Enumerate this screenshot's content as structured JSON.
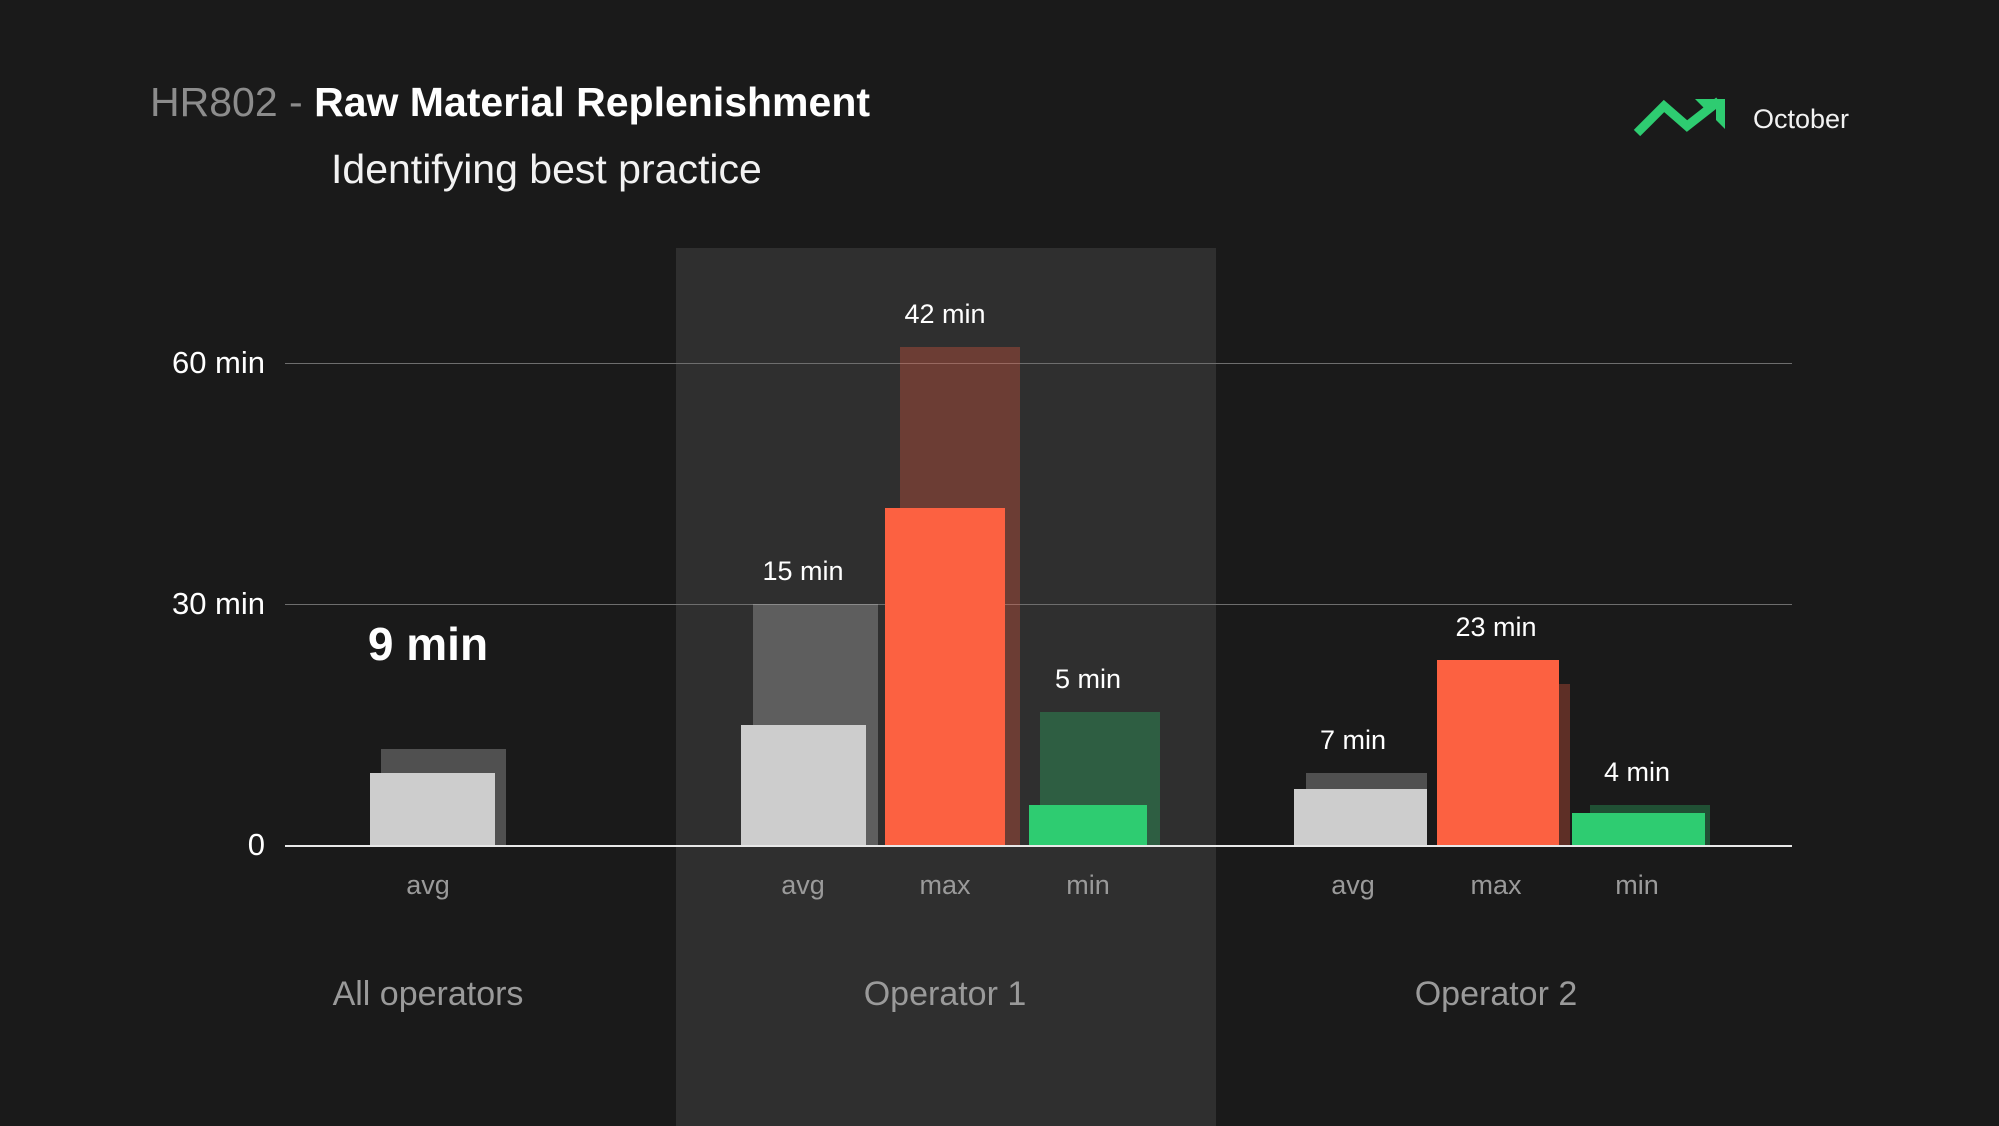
{
  "header": {
    "code": "HR802",
    "separator": "-",
    "name": "Raw Material Replenishment",
    "subtitle": "Identifying best practice",
    "period_label": "October",
    "trend_icon": "trend-up-arrow-icon"
  },
  "colors": {
    "background": "#1a1a1a",
    "highlight_panel": "#2f2f2f",
    "avg": "#cdcdcd",
    "max": "#fc6141",
    "min": "#2ecc71",
    "gridline": "#6e6e6e",
    "axis": "#e8e8e8",
    "tick_text": "#ffffff",
    "muted_text": "#9a9a9a",
    "accent_green": "#2ecc71"
  },
  "chart_data": {
    "type": "bar",
    "title": "HR802 - Raw Material Replenishment",
    "subtitle": "Identifying best practice",
    "xlabel": "",
    "ylabel": "",
    "ylim": [
      0,
      72
    ],
    "grid": true,
    "legend": "none",
    "y_ticks": [
      {
        "value": 0,
        "label": "0"
      },
      {
        "value": 30,
        "label": "30 min"
      },
      {
        "value": 60,
        "label": "60 min"
      }
    ],
    "unit": "min",
    "groups": [
      {
        "name": "All operators",
        "highlighted": false,
        "bars": [
          {
            "category": "avg",
            "label": "9 min",
            "value": 9,
            "reference": 12,
            "color": "#cdcdcd",
            "emphasis": true
          }
        ]
      },
      {
        "name": "Operator 1",
        "highlighted": true,
        "bars": [
          {
            "category": "avg",
            "label": "15 min",
            "value": 15,
            "reference": 30,
            "color": "#cdcdcd",
            "emphasis": false
          },
          {
            "category": "max",
            "label": "42 min",
            "value": 42,
            "reference": 62,
            "color": "#fc6141",
            "emphasis": false
          },
          {
            "category": "min",
            "label": "5 min",
            "value": 5,
            "reference": 16.5,
            "color": "#2ecc71",
            "emphasis": false
          }
        ]
      },
      {
        "name": "Operator 2",
        "highlighted": false,
        "bars": [
          {
            "category": "avg",
            "label": "7 min",
            "value": 7,
            "reference": 9,
            "color": "#cdcdcd",
            "emphasis": false
          },
          {
            "category": "max",
            "label": "23 min",
            "value": 23,
            "reference": 20,
            "color": "#fc6141",
            "emphasis": false
          },
          {
            "category": "min",
            "label": "4 min",
            "value": 4,
            "reference": 5,
            "color": "#2ecc71",
            "emphasis": false
          }
        ]
      }
    ]
  }
}
